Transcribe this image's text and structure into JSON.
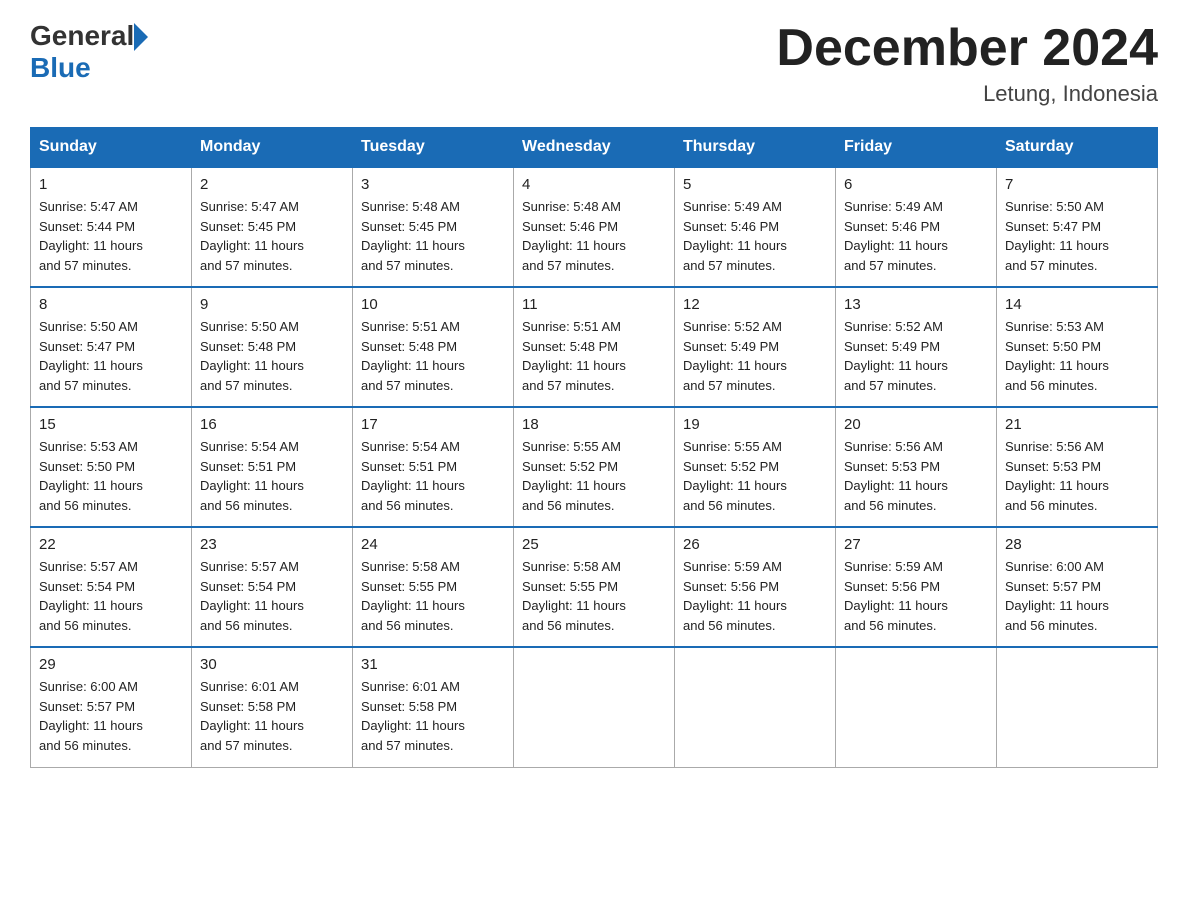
{
  "header": {
    "logo_general": "General",
    "logo_blue": "Blue",
    "month_title": "December 2024",
    "location": "Letung, Indonesia"
  },
  "weekdays": [
    "Sunday",
    "Monday",
    "Tuesday",
    "Wednesday",
    "Thursday",
    "Friday",
    "Saturday"
  ],
  "weeks": [
    [
      {
        "day": "1",
        "sunrise": "5:47 AM",
        "sunset": "5:44 PM",
        "daylight": "11 hours and 57 minutes."
      },
      {
        "day": "2",
        "sunrise": "5:47 AM",
        "sunset": "5:45 PM",
        "daylight": "11 hours and 57 minutes."
      },
      {
        "day": "3",
        "sunrise": "5:48 AM",
        "sunset": "5:45 PM",
        "daylight": "11 hours and 57 minutes."
      },
      {
        "day": "4",
        "sunrise": "5:48 AM",
        "sunset": "5:46 PM",
        "daylight": "11 hours and 57 minutes."
      },
      {
        "day": "5",
        "sunrise": "5:49 AM",
        "sunset": "5:46 PM",
        "daylight": "11 hours and 57 minutes."
      },
      {
        "day": "6",
        "sunrise": "5:49 AM",
        "sunset": "5:46 PM",
        "daylight": "11 hours and 57 minutes."
      },
      {
        "day": "7",
        "sunrise": "5:50 AM",
        "sunset": "5:47 PM",
        "daylight": "11 hours and 57 minutes."
      }
    ],
    [
      {
        "day": "8",
        "sunrise": "5:50 AM",
        "sunset": "5:47 PM",
        "daylight": "11 hours and 57 minutes."
      },
      {
        "day": "9",
        "sunrise": "5:50 AM",
        "sunset": "5:48 PM",
        "daylight": "11 hours and 57 minutes."
      },
      {
        "day": "10",
        "sunrise": "5:51 AM",
        "sunset": "5:48 PM",
        "daylight": "11 hours and 57 minutes."
      },
      {
        "day": "11",
        "sunrise": "5:51 AM",
        "sunset": "5:48 PM",
        "daylight": "11 hours and 57 minutes."
      },
      {
        "day": "12",
        "sunrise": "5:52 AM",
        "sunset": "5:49 PM",
        "daylight": "11 hours and 57 minutes."
      },
      {
        "day": "13",
        "sunrise": "5:52 AM",
        "sunset": "5:49 PM",
        "daylight": "11 hours and 57 minutes."
      },
      {
        "day": "14",
        "sunrise": "5:53 AM",
        "sunset": "5:50 PM",
        "daylight": "11 hours and 56 minutes."
      }
    ],
    [
      {
        "day": "15",
        "sunrise": "5:53 AM",
        "sunset": "5:50 PM",
        "daylight": "11 hours and 56 minutes."
      },
      {
        "day": "16",
        "sunrise": "5:54 AM",
        "sunset": "5:51 PM",
        "daylight": "11 hours and 56 minutes."
      },
      {
        "day": "17",
        "sunrise": "5:54 AM",
        "sunset": "5:51 PM",
        "daylight": "11 hours and 56 minutes."
      },
      {
        "day": "18",
        "sunrise": "5:55 AM",
        "sunset": "5:52 PM",
        "daylight": "11 hours and 56 minutes."
      },
      {
        "day": "19",
        "sunrise": "5:55 AM",
        "sunset": "5:52 PM",
        "daylight": "11 hours and 56 minutes."
      },
      {
        "day": "20",
        "sunrise": "5:56 AM",
        "sunset": "5:53 PM",
        "daylight": "11 hours and 56 minutes."
      },
      {
        "day": "21",
        "sunrise": "5:56 AM",
        "sunset": "5:53 PM",
        "daylight": "11 hours and 56 minutes."
      }
    ],
    [
      {
        "day": "22",
        "sunrise": "5:57 AM",
        "sunset": "5:54 PM",
        "daylight": "11 hours and 56 minutes."
      },
      {
        "day": "23",
        "sunrise": "5:57 AM",
        "sunset": "5:54 PM",
        "daylight": "11 hours and 56 minutes."
      },
      {
        "day": "24",
        "sunrise": "5:58 AM",
        "sunset": "5:55 PM",
        "daylight": "11 hours and 56 minutes."
      },
      {
        "day": "25",
        "sunrise": "5:58 AM",
        "sunset": "5:55 PM",
        "daylight": "11 hours and 56 minutes."
      },
      {
        "day": "26",
        "sunrise": "5:59 AM",
        "sunset": "5:56 PM",
        "daylight": "11 hours and 56 minutes."
      },
      {
        "day": "27",
        "sunrise": "5:59 AM",
        "sunset": "5:56 PM",
        "daylight": "11 hours and 56 minutes."
      },
      {
        "day": "28",
        "sunrise": "6:00 AM",
        "sunset": "5:57 PM",
        "daylight": "11 hours and 56 minutes."
      }
    ],
    [
      {
        "day": "29",
        "sunrise": "6:00 AM",
        "sunset": "5:57 PM",
        "daylight": "11 hours and 56 minutes."
      },
      {
        "day": "30",
        "sunrise": "6:01 AM",
        "sunset": "5:58 PM",
        "daylight": "11 hours and 57 minutes."
      },
      {
        "day": "31",
        "sunrise": "6:01 AM",
        "sunset": "5:58 PM",
        "daylight": "11 hours and 57 minutes."
      },
      null,
      null,
      null,
      null
    ]
  ],
  "labels": {
    "sunrise": "Sunrise:",
    "sunset": "Sunset:",
    "daylight": "Daylight:"
  }
}
